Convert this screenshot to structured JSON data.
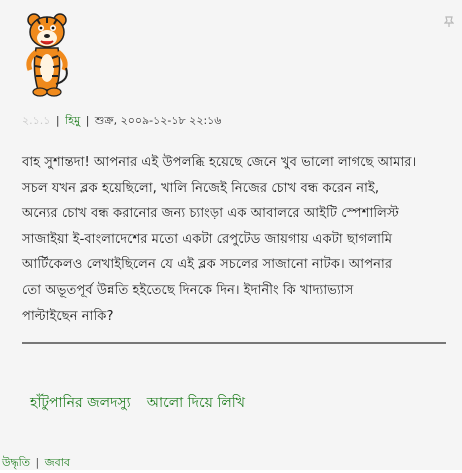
{
  "comment": {
    "number": "২.১.১",
    "author": "হিমু",
    "datetime": "শুক্র, ২০০৯-১২-১৮ ২২:১৬",
    "separator": "|",
    "body_lines": [
      "বাহ সুশান্তদা! আপনার এই উপলব্ধি হয়েছে জেনে খুব ভালো লাগছে আমার।",
      "সচল যখন ব্লক হয়েছিলো, খালি নিজেই নিজের চোখ বন্ধ করেন নাই,",
      "অন্যের চোখ বন্ধ করানোর জন্য চ্যাংড়া এক আবালরে আইটি স্পেশালিস্ট",
      "সাজাইয়া ই-বাংলাদেশের মতো একটা রেপুটেড জায়গায় একটা ছাগলামি",
      "আর্টিকেলও লেখাইছিলেন যে এই ব্লক সচলের সাজানো নাটক। আপনার",
      "তো অভূতপূর্ব উন্নতি হইতেছে দিনকে দিন। ইদানীং কি খাদ্যাভ্যাস",
      "পাল্টাইছেন নাকি?"
    ],
    "signature_links": [
      "হাঁটুপানির জলদস্যু",
      "আলো দিয়ে লিখি"
    ],
    "actions": {
      "quote": "উদ্ধৃতি",
      "reply": "জবাব"
    }
  },
  "icons": {
    "avatar": "tiger-avatar-icon",
    "corner": "pin-icon"
  },
  "colors": {
    "link": "#1a7a1a",
    "background": "#f5f5f5",
    "muted": "#c8c8c8",
    "avatar_orange": "#f08a1c"
  }
}
